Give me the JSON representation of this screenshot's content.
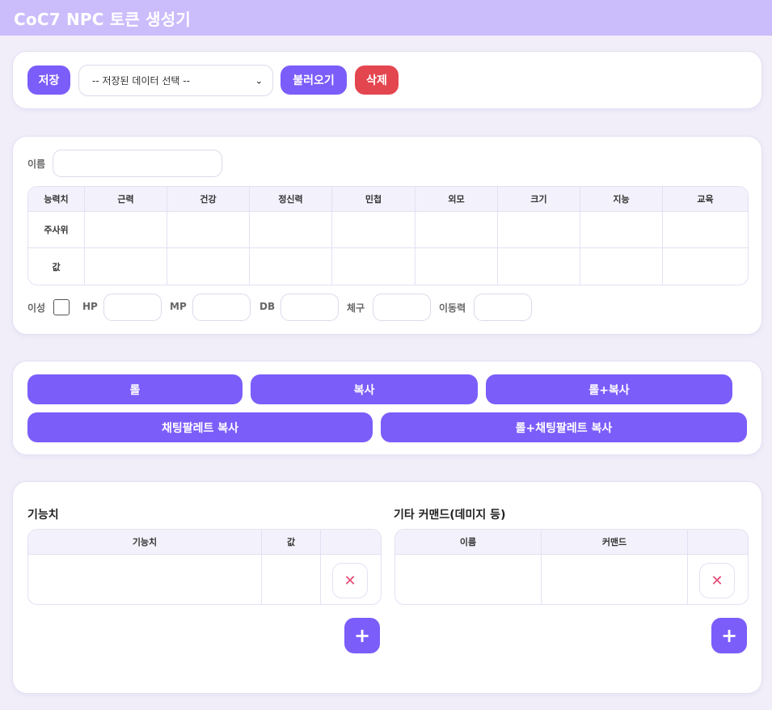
{
  "header": {
    "title": "CoC7 NPC 토큰 생성기"
  },
  "savebar": {
    "save_label": "저장",
    "select_value": "-- 저장된 데이터 선택 --",
    "load_label": "불러오기",
    "delete_label": "삭제"
  },
  "stats": {
    "name_label": "이름",
    "name_value": "",
    "columns": [
      "능력치",
      "근력",
      "건강",
      "정신력",
      "민첩",
      "외모",
      "크기",
      "지능",
      "교육"
    ],
    "rows": [
      {
        "label": "주사위",
        "values": [
          "",
          "",
          "",
          "",
          "",
          "",
          "",
          ""
        ]
      },
      {
        "label": "값",
        "values": [
          "",
          "",
          "",
          "",
          "",
          "",
          "",
          ""
        ]
      }
    ],
    "extra": {
      "sanity_label": "이성",
      "sanity_checked": false,
      "hp_label": "HP",
      "mp_label": "MP",
      "db_label": "DB",
      "build_label": "체구",
      "move_label": "이동력"
    }
  },
  "actions": {
    "roll": "롤",
    "copy": "복사",
    "roll_copy": "롤+복사",
    "chat_copy": "채팅팔레트 복사",
    "roll_chat_copy": "롤+채팅팔레트 복사"
  },
  "skills": {
    "title": "기능치",
    "col_name": "기능치",
    "col_value": "값",
    "delete_icon": "close-icon",
    "add_icon": "plus-icon"
  },
  "commands": {
    "title": "기타 커맨드(데미지 등)",
    "col_name": "이름",
    "col_command": "커맨드",
    "delete_icon": "close-icon",
    "add_icon": "plus-icon"
  },
  "colors": {
    "accent": "#7b5dfa",
    "header": "#cbbdfb",
    "danger": "#e4464f",
    "background": "#f1eef9"
  }
}
